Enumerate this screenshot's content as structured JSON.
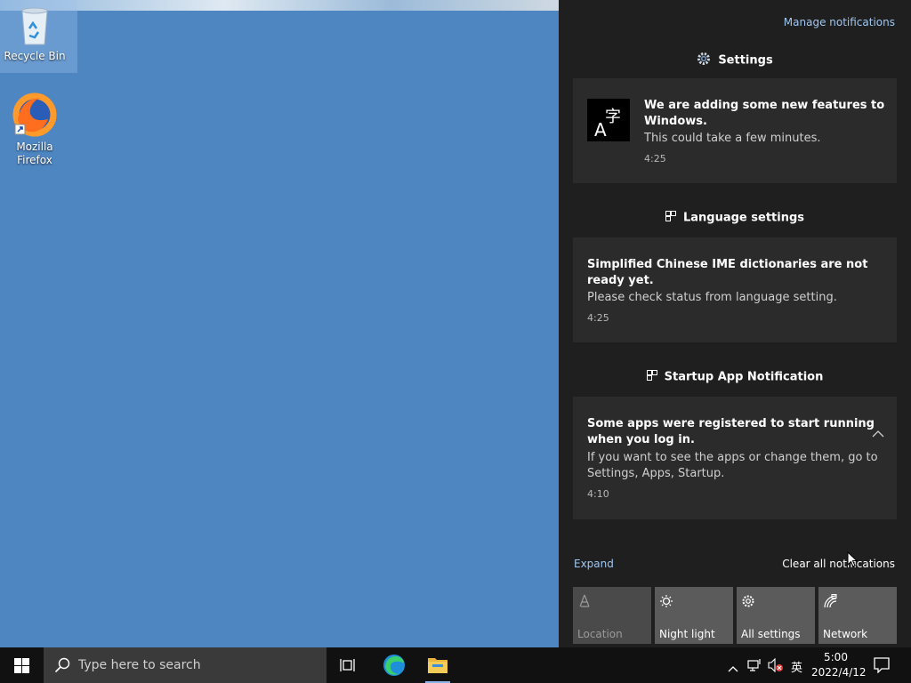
{
  "desktop": {
    "icons": [
      {
        "label": "Recycle Bin"
      },
      {
        "label_line1": "Mozilla",
        "label_line2": "Firefox"
      }
    ]
  },
  "action_center": {
    "manage_label": "Manage notifications",
    "groups": [
      {
        "app": "Settings",
        "title": "We are adding some new features to Windows.",
        "title_line1": "We are adding some new features to",
        "title_line2": "Windows.",
        "body": "This could take a few minutes.",
        "time": "4:25"
      },
      {
        "app": "Language settings",
        "title": "Simplified Chinese IME dictionaries are not ready yet.",
        "title_line1": "Simplified Chinese IME dictionaries are not",
        "title_line2": "ready yet.",
        "body": "Please check status from language setting.",
        "time": "4:25"
      },
      {
        "app": "Startup App Notification",
        "title": "Some apps were registered to start running when you log in.",
        "title_line1": "Some apps were registered to start running",
        "title_line2": "when you log in.",
        "body": "If you want to see the apps or change them, go to Settings, Apps, Startup.",
        "body_line1": "If you want to see the apps or change them, go to",
        "body_line2": "Settings, Apps, Startup.",
        "time": "4:10"
      }
    ],
    "expand_label": "Expand",
    "clear_label": "Clear all notifications",
    "quick_actions": [
      {
        "label": "Location",
        "icon": "location-icon",
        "enabled": false
      },
      {
        "label": "Night light",
        "icon": "night-light-icon",
        "enabled": true
      },
      {
        "label": "All settings",
        "icon": "settings-gear-icon",
        "enabled": true
      },
      {
        "label": "Network",
        "icon": "network-icon",
        "enabled": true
      }
    ]
  },
  "taskbar": {
    "search_placeholder": "Type here to search",
    "ime": "英",
    "time": "5:00",
    "date": "2022/4/12"
  },
  "colors": {
    "desktop": "#4e86c2",
    "panel": "#1f1f1f",
    "card": "#2b2b2b",
    "link": "#9fc7f2",
    "taskbar": "#111111"
  }
}
